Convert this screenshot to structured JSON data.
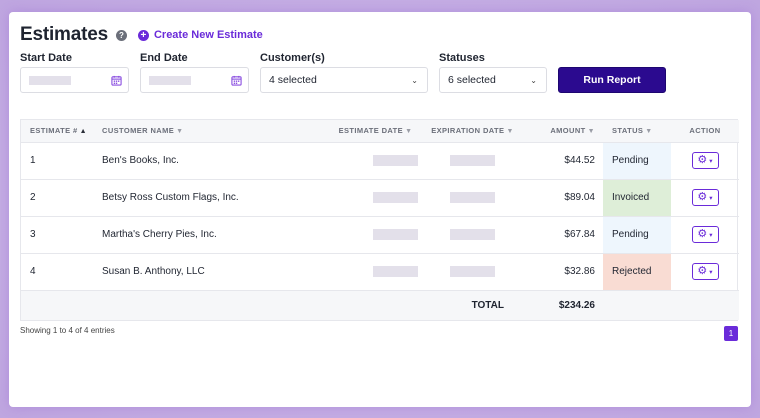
{
  "header": {
    "title": "Estimates",
    "help_glyph": "?",
    "create_icon_glyph": "+",
    "create_label": "Create New Estimate"
  },
  "filters": {
    "start_date_label": "Start Date",
    "end_date_label": "End Date",
    "customers_label": "Customer(s)",
    "customers_value": "4 selected",
    "statuses_label": "Statuses",
    "statuses_value": "6 selected",
    "run_report_label": "Run Report",
    "chevron_glyph": "⌄"
  },
  "table": {
    "columns": {
      "estimate_no": "ESTIMATE #",
      "customer_name": "CUSTOMER NAME",
      "estimate_date": "ESTIMATE DATE",
      "expiration_date": "EXPIRATION DATE",
      "amount": "AMOUNT",
      "status": "STATUS",
      "action": "ACTION"
    },
    "sort_glyphs": {
      "asc": "▲",
      "none": "▼"
    },
    "rows": [
      {
        "id": "1",
        "customer": "Ben's Books, Inc.",
        "amount": "$44.52",
        "status": "Pending"
      },
      {
        "id": "2",
        "customer": "Betsy Ross Custom Flags, Inc.",
        "amount": "$89.04",
        "status": "Invoiced"
      },
      {
        "id": "3",
        "customer": "Martha's Cherry Pies, Inc.",
        "amount": "$67.84",
        "status": "Pending"
      },
      {
        "id": "4",
        "customer": "Susan B. Anthony, LLC",
        "amount": "$32.86",
        "status": "Rejected"
      }
    ],
    "total_label": "TOTAL",
    "total_value": "$234.26",
    "action_icon": "gear-icon"
  },
  "footer": {
    "entries_text": "Showing 1 to 4 of 4 entries",
    "current_page": "1"
  },
  "colors": {
    "accent": "#6a2bd9",
    "run_button": "#2b0a8f",
    "pending_bg": "#eef6fd",
    "invoiced_bg": "#deeed8",
    "rejected_bg": "#f9dcd3"
  }
}
